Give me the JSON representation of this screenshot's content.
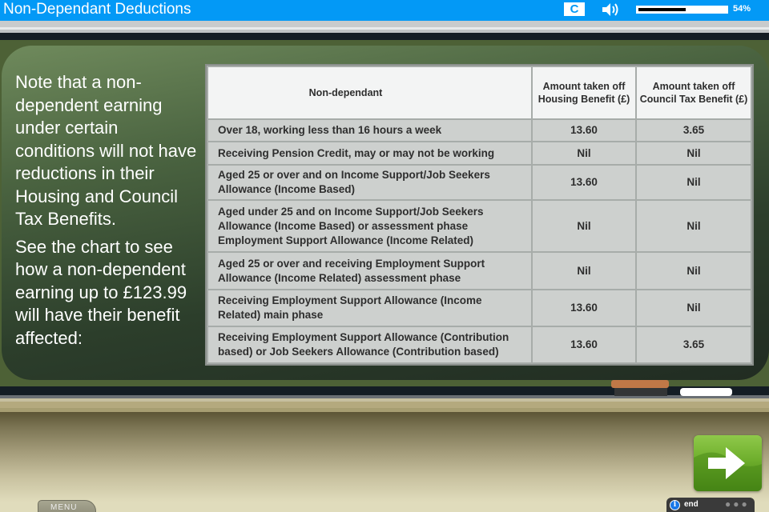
{
  "header": {
    "title": "Non-Dependant Deductions",
    "reload_icon": "reload-icon",
    "reload_label": "C",
    "audio_icon": "speaker-icon",
    "progress_percent": 54,
    "progress_label": "54%"
  },
  "notes": {
    "paragraph_1": "Note that a non-dependent earning under certain conditions will not have reductions in their Housing and Council Tax Benefits.",
    "paragraph_2": "See the chart to see how a non-dependent earning up to £123.99 will have their benefit affected:"
  },
  "table": {
    "headers": [
      "Non-dependant",
      "Amount taken off Housing Benefit (£)",
      "Amount taken off Council Tax Benefit (£)"
    ],
    "rows": [
      {
        "description": "Over 18, working less than 16 hours a week",
        "housing": "13.60",
        "council": "3.65"
      },
      {
        "description": "Receiving Pension Credit, may or may not be working",
        "housing": "Nil",
        "council": "Nil"
      },
      {
        "description": "Aged 25 or over and on Income Support/Job Seekers Allowance (Income Based)",
        "housing": "13.60",
        "council": "Nil"
      },
      {
        "description": "Aged under 25 and on Income Support/Job Seekers Allowance (Income Based) or assessment phase Employment Support Allowance (Income Related)",
        "housing": "Nil",
        "council": "Nil"
      },
      {
        "description": "Aged 25 or over and receiving Employment Support Allowance (Income Related) assessment phase",
        "housing": "Nil",
        "council": "Nil"
      },
      {
        "description": "Receiving Employment Support Allowance (Income Related) main phase",
        "housing": "13.60",
        "council": "Nil"
      },
      {
        "description": "Receiving Employment Support Allowance (Contribution based) or Job Seekers Allowance (Contribution based)",
        "housing": "13.60",
        "council": "3.65"
      }
    ]
  },
  "footer": {
    "next_icon": "arrow-right-icon",
    "menu_label": "MENU",
    "info_icon": "info-icon",
    "info_glyph": "i",
    "end_label": "end",
    "more_icon": "more-dots-icon",
    "more_glyph": "●●●"
  },
  "colors": {
    "header_blue": "#0399f6",
    "board_green": "#4a6340",
    "next_green": "#6eae2c"
  }
}
